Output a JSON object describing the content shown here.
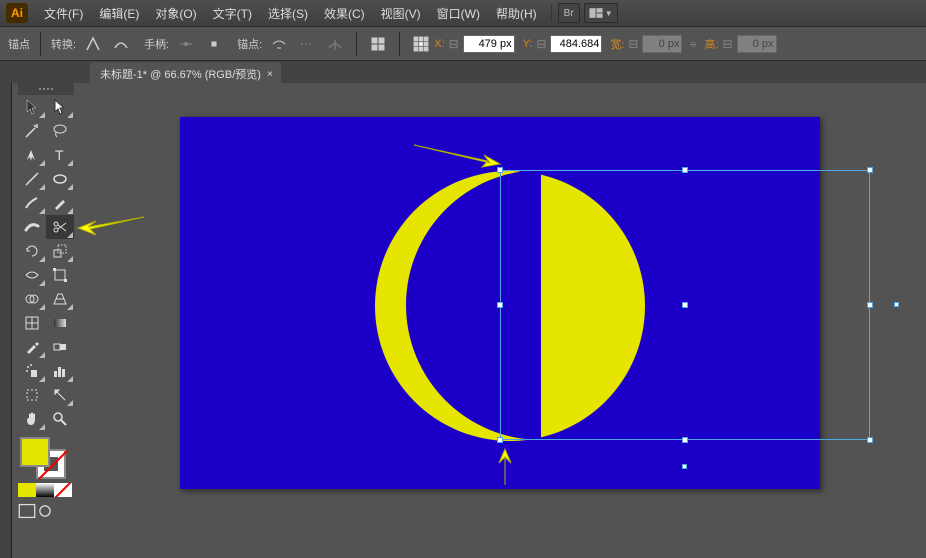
{
  "app": {
    "logo": "Ai"
  },
  "menu": {
    "file": "文件(F)",
    "edit": "编辑(E)",
    "object": "对象(O)",
    "text": "文字(T)",
    "select": "选择(S)",
    "effect": "效果(C)",
    "view": "视图(V)",
    "window": "窗口(W)",
    "help": "帮助(H)"
  },
  "controlbar": {
    "anchor": "锚点",
    "convert": "转换:",
    "handle": "手柄:",
    "anchors_label": "锚点:",
    "x_label": "X:",
    "x_value": "479 px",
    "y_label": "Y:",
    "y_value": "484.684",
    "w_label": "宽:",
    "w_value": "0 px",
    "h_label": "高:",
    "h_value": "0 px"
  },
  "tab": {
    "title": "未标题-1* @ 66.67% (RGB/预览)",
    "close": "×"
  },
  "tools": {
    "list": [
      "selection",
      "direct-select",
      "magic-wand",
      "lasso",
      "pen",
      "type",
      "line",
      "ellipse",
      "brush",
      "blob-brush",
      "eraser",
      "scissors",
      "rotate",
      "reflect",
      "scale",
      "width",
      "free-transform",
      "shape-builder",
      "perspective",
      "mesh",
      "gradient",
      "eyedropper",
      "blend",
      "symbol-spray",
      "column-graph",
      "artboard",
      "slice",
      "hand",
      "zoom"
    ],
    "fill_color": "#e5e500",
    "mini_colors": [
      "#e5e500",
      "#000000",
      "none"
    ]
  },
  "canvas": {
    "bg_color": "#1c00c8",
    "shape_color": "#e5e500"
  }
}
